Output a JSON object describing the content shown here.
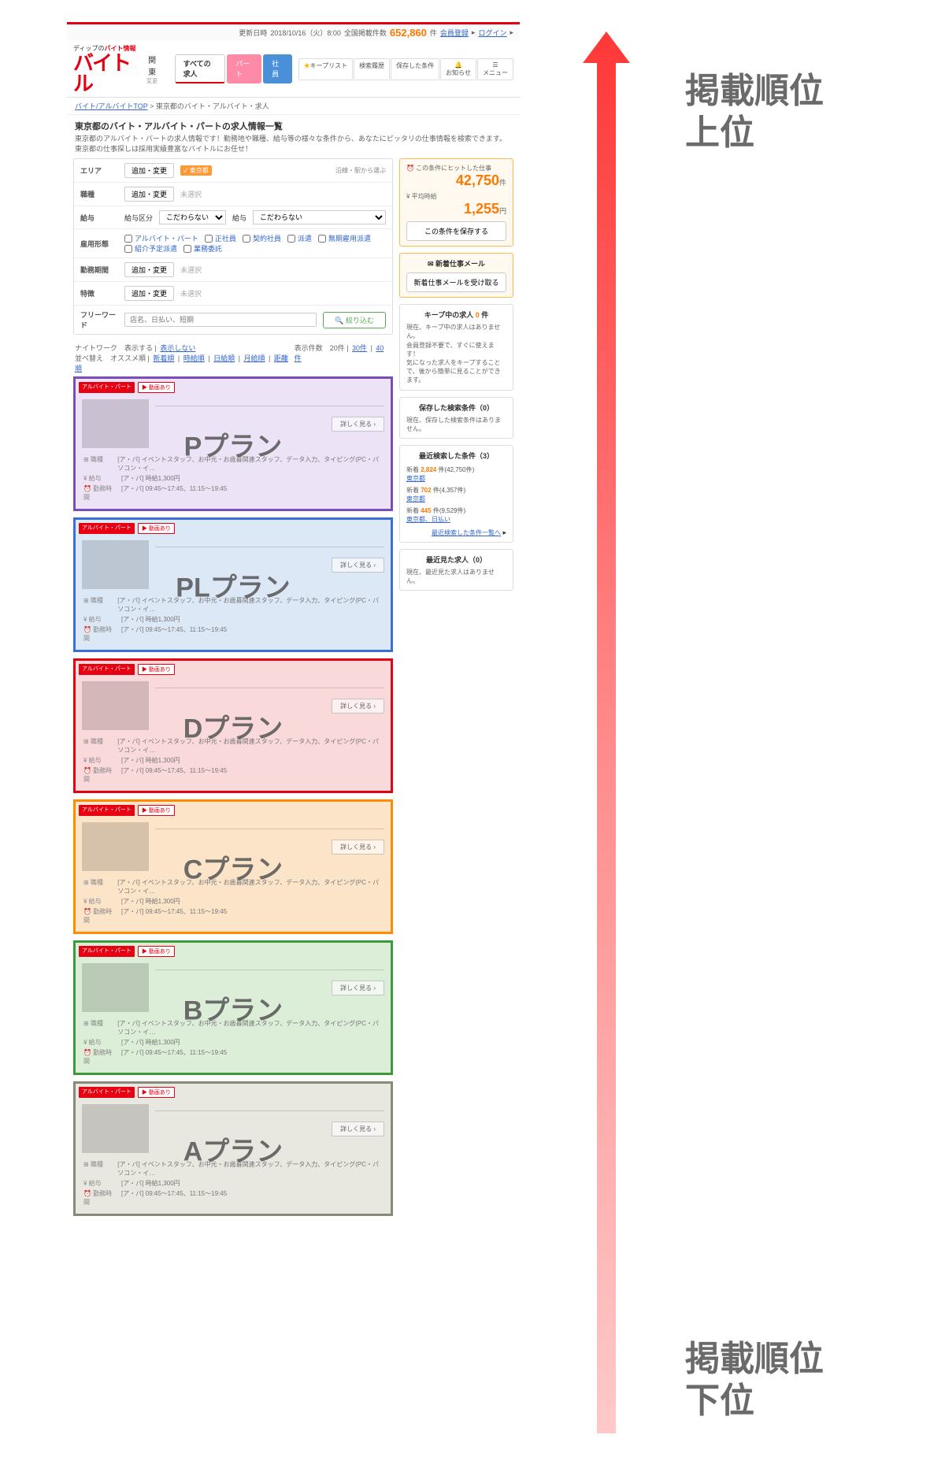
{
  "topbar": {
    "update_label": "更新日時",
    "update_value": "2018/10/16（火）8:00",
    "count_label": "全国掲載件数",
    "count_value": "652,860",
    "count_unit": "件",
    "register": "会員登録",
    "login": "ログイン"
  },
  "logo": {
    "tagline_pre": "ディップの",
    "tagline_b": "バイト情報",
    "brand": "バイトル",
    "region": "関東",
    "region_sub": "変更"
  },
  "tabs": {
    "all": "すべての求人",
    "part": "パート",
    "staff": "社員"
  },
  "header_icons": {
    "keep": "キープリスト",
    "history": "検索履歴",
    "saved": "保存した条件",
    "notice": "お知らせ",
    "menu": "メニュー"
  },
  "breadcrumb": {
    "a": "バイト/アルバイトTOP",
    "b": "東京都のバイト・アルバイト・求人"
  },
  "page": {
    "title": "東京都のバイト・アルバイト・パートの求人情報一覧",
    "desc": "東京都のアルバイト・パートの求人情報です！勤務地や職種、給与等の様々な条件から、あなたにピッタリの仕事情報を検索できます。東京都の仕事探しは採用実績豊富なバイトルにお任せ！"
  },
  "search": {
    "area": {
      "label": "エリア",
      "btn": "追加・変更",
      "tag": "東京都",
      "link": "沿線・駅から選ぶ"
    },
    "job": {
      "label": "職種",
      "btn": "追加・変更",
      "text": "未選択"
    },
    "salary": {
      "label": "給与",
      "type_label": "給与区分",
      "type_val": "こだわらない",
      "amt_label": "給与",
      "amt_val": "こだわらない"
    },
    "employ": {
      "label": "雇用形態",
      "opts": [
        "アルバイト・パート",
        "正社員",
        "契約社員",
        "派遣",
        "無期雇用派遣",
        "紹介予定派遣",
        "業務委託"
      ]
    },
    "period": {
      "label": "勤務期間",
      "btn": "追加・変更",
      "text": "未選択"
    },
    "feature": {
      "label": "特徴",
      "btn": "追加・変更",
      "text": "未選択"
    },
    "freeword": {
      "label": "フリーワード",
      "placeholder": "店名、日払い、短期",
      "btn": "絞り込む"
    }
  },
  "list_ctrl": {
    "night_label": "ナイトワーク",
    "show": "表示する",
    "hide": "表示しない",
    "sort_label": "並べ替え",
    "sort_opts": [
      "オススメ順",
      "新着順",
      "時給順",
      "日給順",
      "月給順",
      "距離順"
    ],
    "count_label": "表示件数",
    "count_now": "20件",
    "count_opts": [
      "30件",
      "40件"
    ]
  },
  "side": {
    "hit": {
      "label": "この条件にヒットした仕事",
      "value": "42,750",
      "unit": "件",
      "avg_label": "平均時給",
      "avg_value": "1,255",
      "avg_unit": "円",
      "save_btn": "この条件を保存する"
    },
    "mail": {
      "title": "新着仕事メール",
      "btn": "新着仕事メールを受け取る"
    },
    "keep": {
      "title_pre": "キープ中の求人",
      "title_num": "0",
      "title_suf": "件",
      "text": "現在、キープ中の求人はありません。\n会員登録不要で、すぐに使えます！\n気になった求人をキープすることで、後から簡単に見ることができます。"
    },
    "saved": {
      "title": "保存した検索条件（0）",
      "text": "現在、保存した検索条件はありません。"
    },
    "recent": {
      "title": "最近検索した条件（3）",
      "items": [
        {
          "new": "新着",
          "count": "2,824",
          "total": "件(42,750件)",
          "area": "東京都"
        },
        {
          "new": "新着",
          "count": "702",
          "total": "件(4,357件)",
          "area": "東京都"
        },
        {
          "new": "新着",
          "count": "445",
          "total": "件(9,529件)",
          "area": "東京都、日払い"
        }
      ],
      "more": "最近検索した条件一覧へ"
    },
    "viewed": {
      "title": "最近見た求人（0）",
      "text": "現在、最近見た求人はありません。"
    }
  },
  "job": {
    "badge1": "アルバイト・パート",
    "badge2": "動画あり",
    "detail_btn": "詳しく見る",
    "desc": "[ア・パ] イベントスタッフ、お中元・お歳暮関連スタッフ、データ入力、タイピング(PC・パソコン・イ…",
    "salary_label": "給与",
    "salary_val": "[ア・パ] 時給1,300円",
    "time_label": "勤務時間",
    "time_val": "[ア・パ] 09:45〜17:45、11:15〜19:45",
    "job_label": "職種"
  },
  "plans": [
    {
      "key": "p",
      "label": "Pプラン"
    },
    {
      "key": "pl",
      "label": "PLプラン"
    },
    {
      "key": "d",
      "label": "Dプラン"
    },
    {
      "key": "c",
      "label": "Cプラン"
    },
    {
      "key": "b",
      "label": "Bプラン"
    },
    {
      "key": "a",
      "label": "Aプラン"
    }
  ],
  "rank": {
    "top": "掲載順位\n上位",
    "bottom": "掲載順位\n下位"
  }
}
